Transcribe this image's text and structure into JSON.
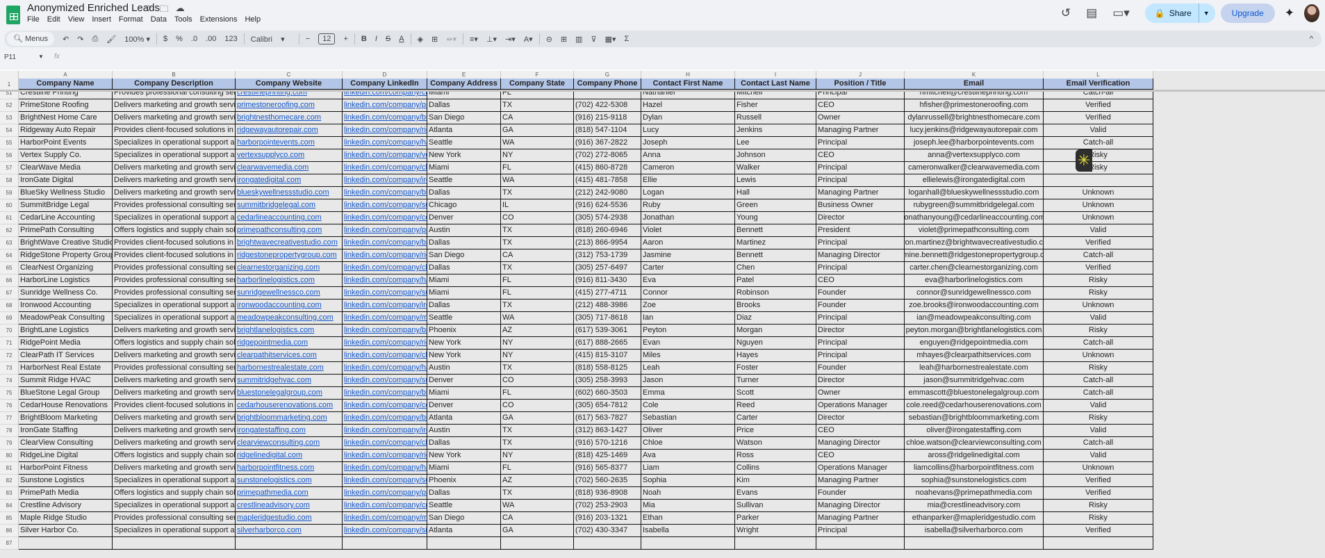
{
  "app": {
    "title": "Anonymized Enriched Leads",
    "menu": [
      "File",
      "Edit",
      "View",
      "Insert",
      "Format",
      "Data",
      "Tools",
      "Extensions",
      "Help"
    ],
    "share": "Share",
    "upgrade": "Upgrade",
    "accent": "#c2e7ff",
    "header_fill": "#b4c6e7"
  },
  "toolbar": {
    "menus": "Menus",
    "zoom": "100%",
    "currency": "$",
    "percent": "%",
    "dec_less": ".0",
    "dec_more": ".00",
    "format_123": "123",
    "font": "Calibri",
    "font_size": "12"
  },
  "formula_bar": {
    "cell_ref": "P11",
    "fx": "fx"
  },
  "columns": [
    "A",
    "B",
    "C",
    "D",
    "E",
    "F",
    "G",
    "H",
    "I",
    "J",
    "K",
    "L"
  ],
  "headers": [
    "Company Name",
    "Company Description",
    "Company Website",
    "Company LinkedIn",
    "Company Address",
    "Company State",
    "Company Phone",
    "Contact First Name",
    "Contact Last Name",
    "Position / Title",
    "Email",
    "Email Verification"
  ],
  "header_row_number": "1",
  "rows": [
    [
      "51",
      "Crestline Printing",
      "Provides professional consulting services",
      "crestlineprinting.com",
      "linkedin.com/company/crestlineprinting",
      "Miami",
      "FL",
      "",
      "Nathaniel",
      "Mitchell",
      "Principal",
      "nmitchell@crestlineprinting.com",
      "Catch-all"
    ],
    [
      "52",
      "PrimeStone Roofing",
      "Delivers marketing and growth services",
      "primestoneroofing.com",
      "linkedin.com/company/primestoneroofing",
      "Dallas",
      "TX",
      "(702) 422-5308",
      "Hazel",
      "Fisher",
      "CEO",
      "hfisher@primestoneroofing.com",
      "Verified"
    ],
    [
      "53",
      "BrightNest Home Care",
      "Delivers marketing and growth services",
      "brightnesthomecare.com",
      "linkedin.com/company/brightnesthomecare",
      "San Diego",
      "CA",
      "(916) 215-9118",
      "Dylan",
      "Russell",
      "Owner",
      "dylanrussell@brightnesthomecare.com",
      "Verified"
    ],
    [
      "54",
      "Ridgeway Auto Repair",
      "Provides client-focused solutions in its i",
      "ridgewayautorepair.com",
      "linkedin.com/company/ridgewayautorepair",
      "Atlanta",
      "GA",
      "(818) 547-1104",
      "Lucy",
      "Jenkins",
      "Managing Partner",
      "lucy.jenkins@ridgewayautorepair.com",
      "Valid"
    ],
    [
      "55",
      "HarborPoint Events",
      "Specializes in operational support and b",
      "harborpointevents.com",
      "linkedin.com/company/harborpointevents",
      "Seattle",
      "WA",
      "(916) 367-2822",
      "Joseph",
      "Lee",
      "Principal",
      "joseph.lee@harborpointevents.com",
      "Catch-all"
    ],
    [
      "56",
      "Vertex Supply Co.",
      "Specializes in operational support and b",
      "vertexsupplyco.com",
      "linkedin.com/company/vertexsupplyco",
      "New York",
      "NY",
      "(702) 272-8065",
      "Anna",
      "Johnson",
      "CEO",
      "anna@vertexsupplyco.com",
      "Risky"
    ],
    [
      "57",
      "ClearWave Media",
      "Delivers marketing and growth services",
      "clearwavemedia.com",
      "linkedin.com/company/clearwavemedia",
      "Miami",
      "FL",
      "(415) 860-8728",
      "Cameron",
      "Walker",
      "Principal",
      "cameronwalker@clearwavemedia.com",
      "Risky"
    ],
    [
      "58",
      "IronGate Digital",
      "Delivers marketing and growth services",
      "irongatedigital.com",
      "linkedin.com/company/irongatedigital",
      "Seattle",
      "WA",
      "(415) 481-7858",
      "Ellie",
      "Lewis",
      "Principal",
      "ellielewis@irongatedigital.com",
      ""
    ],
    [
      "59",
      "BlueSky Wellness Studio",
      "Delivers marketing and growth services",
      "blueskywellnessstudio.com",
      "linkedin.com/company/blueskywellnessstudio",
      "Dallas",
      "TX",
      "(212) 242-9080",
      "Logan",
      "Hall",
      "Managing Partner",
      "loganhall@blueskywellnessstudio.com",
      "Unknown"
    ],
    [
      "60",
      "SummitBridge Legal",
      "Provides professional consulting services",
      "summitbridgelegal.com",
      "linkedin.com/company/summitbridgelegal",
      "Chicago",
      "IL",
      "(916) 624-5536",
      "Ruby",
      "Green",
      "Business Owner",
      "rubygreen@summitbridgelegal.com",
      "Unknown"
    ],
    [
      "61",
      "CedarLine Accounting",
      "Specializes in operational support and b",
      "cedarlineaccounting.com",
      "linkedin.com/company/cedarlineaccounting",
      "Denver",
      "CO",
      "(305) 574-2938",
      "Jonathan",
      "Young",
      "Director",
      "jonathanyoung@cedarlineaccounting.com",
      "Unknown"
    ],
    [
      "62",
      "PrimePath Consulting",
      "Offers logistics and supply chain solutions",
      "primepathconsulting.com",
      "linkedin.com/company/primepathconsulting",
      "Austin",
      "TX",
      "(818) 260-6946",
      "Violet",
      "Bennett",
      "President",
      "violet@primepathconsulting.com",
      "Valid"
    ],
    [
      "63",
      "BrightWave Creative Studio",
      "Provides client-focused solutions in its i",
      "brightwavecreativestudio.com",
      "linkedin.com/company/brightwavecreativestudio",
      "Dallas",
      "TX",
      "(213) 866-9954",
      "Aaron",
      "Martinez",
      "Principal",
      "aaron.martinez@brightwavecreativestudio.com",
      "Verified"
    ],
    [
      "64",
      "RidgeStone Property Group",
      "Provides client-focused solutions in its i",
      "ridgestonepropertygroup.com",
      "linkedin.com/company/ridgestonepropertygroup",
      "San Diego",
      "CA",
      "(312) 753-1739",
      "Jasmine",
      "Bennett",
      "Managing Director",
      "jasmine.bennett@ridgestonepropertygroup.com",
      "Catch-all"
    ],
    [
      "65",
      "ClearNest Organizing",
      "Provides professional consulting services",
      "clearnestorganizing.com",
      "linkedin.com/company/clearnestorganizing",
      "Dallas",
      "TX",
      "(305) 257-6497",
      "Carter",
      "Chen",
      "Principal",
      "carter.chen@clearnestorganizing.com",
      "Verified"
    ],
    [
      "66",
      "HarborLine Logistics",
      "Provides professional consulting services",
      "harborlinelogistics.com",
      "linkedin.com/company/harborlinelogistics",
      "Miami",
      "FL",
      "(916) 811-3430",
      "Eva",
      "Patel",
      "CEO",
      "eva@harborlinelogistics.com",
      "Risky"
    ],
    [
      "67",
      "Sunridge Wellness Co.",
      "Provides professional consulting services",
      "sunridgewellnessco.com",
      "linkedin.com/company/sunridgewellnessco",
      "Miami",
      "FL",
      "(415) 277-4711",
      "Connor",
      "Robinson",
      "Founder",
      "connor@sunridgewellnessco.com",
      "Risky"
    ],
    [
      "68",
      "Ironwood Accounting",
      "Specializes in operational support and b",
      "ironwoodaccounting.com",
      "linkedin.com/company/ironwoodaccounting",
      "Dallas",
      "TX",
      "(212) 488-3986",
      "Zoe",
      "Brooks",
      "Founder",
      "zoe.brooks@ironwoodaccounting.com",
      "Unknown"
    ],
    [
      "69",
      "MeadowPeak Consulting",
      "Specializes in operational support and b",
      "meadowpeakconsulting.com",
      "linkedin.com/company/meadowpeakconsulting",
      "Seattle",
      "WA",
      "(305) 717-8618",
      "Ian",
      "Diaz",
      "Principal",
      "ian@meadowpeakconsulting.com",
      "Valid"
    ],
    [
      "70",
      "BrightLane Logistics",
      "Delivers marketing and growth services",
      "brightlanelogistics.com",
      "linkedin.com/company/brightlanelogistics",
      "Phoenix",
      "AZ",
      "(617) 539-3061",
      "Peyton",
      "Morgan",
      "Director",
      "peyton.morgan@brightlanelogistics.com",
      "Risky"
    ],
    [
      "71",
      "RidgePoint Media",
      "Offers logistics and supply chain solutions",
      "ridgepointmedia.com",
      "linkedin.com/company/ridgepointmedia",
      "New York",
      "NY",
      "(617) 888-2665",
      "Evan",
      "Nguyen",
      "Principal",
      "enguyen@ridgepointmedia.com",
      "Catch-all"
    ],
    [
      "72",
      "ClearPath IT Services",
      "Delivers marketing and growth services",
      "clearpathitservices.com",
      "linkedin.com/company/clearpathitservices",
      "New York",
      "NY",
      "(415) 815-3107",
      "Miles",
      "Hayes",
      "Principal",
      "mhayes@clearpathitservices.com",
      "Unknown"
    ],
    [
      "73",
      "HarborNest Real Estate",
      "Provides professional consulting services",
      "harbornestrealestate.com",
      "linkedin.com/company/harbornestrealestate",
      "Austin",
      "TX",
      "(818) 558-8125",
      "Leah",
      "Foster",
      "Founder",
      "leah@harbornestrealestate.com",
      "Risky"
    ],
    [
      "74",
      "Summit Ridge HVAC",
      "Delivers marketing and growth services",
      "summitridgehvac.com",
      "linkedin.com/company/summitridgehvac",
      "Denver",
      "CO",
      "(305) 258-3993",
      "Jason",
      "Turner",
      "Director",
      "jason@summitridgehvac.com",
      "Catch-all"
    ],
    [
      "75",
      "BlueStone Legal Group",
      "Delivers marketing and growth services",
      "bluestonelegalgroup.com",
      "linkedin.com/company/bluestonelegalgroup",
      "Miami",
      "FL",
      "(602) 660-3503",
      "Emma",
      "Scott",
      "Owner",
      "emmascott@bluestonelegalgroup.com",
      "Catch-all"
    ],
    [
      "76",
      "CedarHouse Renovations",
      "Provides client-focused solutions in its i",
      "cedarhouserenovations.com",
      "linkedin.com/company/cedarhouserenovations",
      "Denver",
      "CO",
      "(305) 654-7812",
      "Cole",
      "Reed",
      "Operations Manager",
      "cole.reed@cedarhouserenovations.com",
      "Valid"
    ],
    [
      "77",
      "BrightBloom Marketing",
      "Delivers marketing and growth services",
      "brightbloommarketing.com",
      "linkedin.com/company/brightbloommarketing",
      "Atlanta",
      "GA",
      "(617) 563-7827",
      "Sebastian",
      "Carter",
      "Director",
      "sebastian@brightbloommarketing.com",
      "Risky"
    ],
    [
      "78",
      "IronGate Staffing",
      "Delivers marketing and growth services",
      "irongatestaffing.com",
      "linkedin.com/company/irongatestaffing",
      "Austin",
      "TX",
      "(312) 863-1427",
      "Oliver",
      "Price",
      "CEO",
      "oliver@irongatestaffing.com",
      "Valid"
    ],
    [
      "79",
      "ClearView Consulting",
      "Delivers marketing and growth services",
      "clearviewconsulting.com",
      "linkedin.com/company/clearviewconsulting",
      "Dallas",
      "TX",
      "(916) 570-1216",
      "Chloe",
      "Watson",
      "Managing Director",
      "chloe.watson@clearviewconsulting.com",
      "Catch-all"
    ],
    [
      "80",
      "RidgeLine Digital",
      "Offers logistics and supply chain solutions",
      "ridgelinedigital.com",
      "linkedin.com/company/ridgelinedigital",
      "New York",
      "NY",
      "(818) 425-1469",
      "Ava",
      "Ross",
      "CEO",
      "aross@ridgelinedigital.com",
      "Valid"
    ],
    [
      "81",
      "HarborPoint Fitness",
      "Delivers marketing and growth services",
      "harborpointfitness.com",
      "linkedin.com/company/harborpointfitness",
      "Miami",
      "FL",
      "(916) 565-8377",
      "Liam",
      "Collins",
      "Operations Manager",
      "liamcollins@harborpointfitness.com",
      "Unknown"
    ],
    [
      "82",
      "Sunstone Logistics",
      "Specializes in operational support and b",
      "sunstonelogistics.com",
      "linkedin.com/company/sunstonelogistics",
      "Phoenix",
      "AZ",
      "(702) 560-2635",
      "Sophia",
      "Kim",
      "Managing Partner",
      "sophia@sunstonelogistics.com",
      "Verified"
    ],
    [
      "83",
      "PrimePath Media",
      "Offers logistics and supply chain solutions",
      "primepathmedia.com",
      "linkedin.com/company/primepathmedia",
      "Dallas",
      "TX",
      "(818) 936-8908",
      "Noah",
      "Evans",
      "Founder",
      "noahevans@primepathmedia.com",
      "Verified"
    ],
    [
      "84",
      "Crestline Advisory",
      "Specializes in operational support and b",
      "crestlineadvisory.com",
      "linkedin.com/company/crestlineadvisory",
      "Seattle",
      "WA",
      "(702) 253-2903",
      "Mia",
      "Sullivan",
      "Managing Director",
      "mia@crestlineadvisory.com",
      "Risky"
    ],
    [
      "85",
      "Maple Ridge Studio",
      "Provides professional consulting services",
      "mapleridgestudio.com",
      "linkedin.com/company/mapleridgestudio",
      "San Diego",
      "CA",
      "(916) 203-1321",
      "Ethan",
      "Parker",
      "Managing Partner",
      "ethanparker@mapleridgestudio.com",
      "Risky"
    ],
    [
      "86",
      "Silver Harbor Co.",
      "Specializes in operational support and b",
      "silverharborco.com",
      "linkedin.com/company/silverharborco",
      "Atlanta",
      "GA",
      "(702) 430-3347",
      "Isabella",
      "Wright",
      "Principal",
      "isabella@silverharborco.com",
      "Verified"
    ],
    [
      "87",
      "",
      "",
      "",
      "",
      "",
      "",
      "",
      "",
      "",
      "",
      "",
      ""
    ]
  ]
}
